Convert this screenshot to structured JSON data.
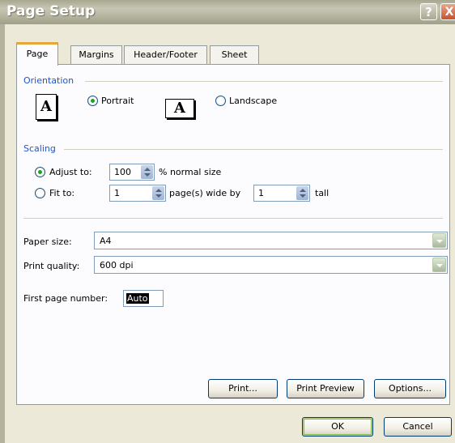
{
  "window": {
    "title": "Page Setup",
    "help_glyph": "?",
    "close_glyph": "X"
  },
  "tabs": [
    "Page",
    "Margins",
    "Header/Footer",
    "Sheet"
  ],
  "active_tab": "Page",
  "orientation": {
    "group_label": "Orientation",
    "portrait": {
      "label": "Portrait",
      "selected": true,
      "icon": "page-portrait-icon",
      "icon_glyph": "A"
    },
    "landscape": {
      "label": "Landscape",
      "selected": false,
      "icon": "page-landscape-icon",
      "icon_glyph": "A"
    }
  },
  "scaling": {
    "group_label": "Scaling",
    "adjust_to": {
      "label": "Adjust to:",
      "value": "100",
      "suffix": "% normal size",
      "selected": true
    },
    "fit_to": {
      "label": "Fit to:",
      "wide_value": "1",
      "wide_suffix": "page(s) wide by",
      "tall_value": "1",
      "tall_suffix": "tall",
      "selected": false
    }
  },
  "paper_size": {
    "label": "Paper size:",
    "value": "A4"
  },
  "print_quality": {
    "label": "Print quality:",
    "value": "600 dpi"
  },
  "first_page_number": {
    "label": "First page number:",
    "value": "Auto"
  },
  "buttons": {
    "print": "Print...",
    "print_preview": "Print Preview",
    "options": "Options...",
    "ok": "OK",
    "cancel": "Cancel"
  },
  "colors": {
    "group_label": "#2155c9",
    "active_tab_accent": "#e6a739",
    "dialog_bg": "#ece9d8"
  }
}
